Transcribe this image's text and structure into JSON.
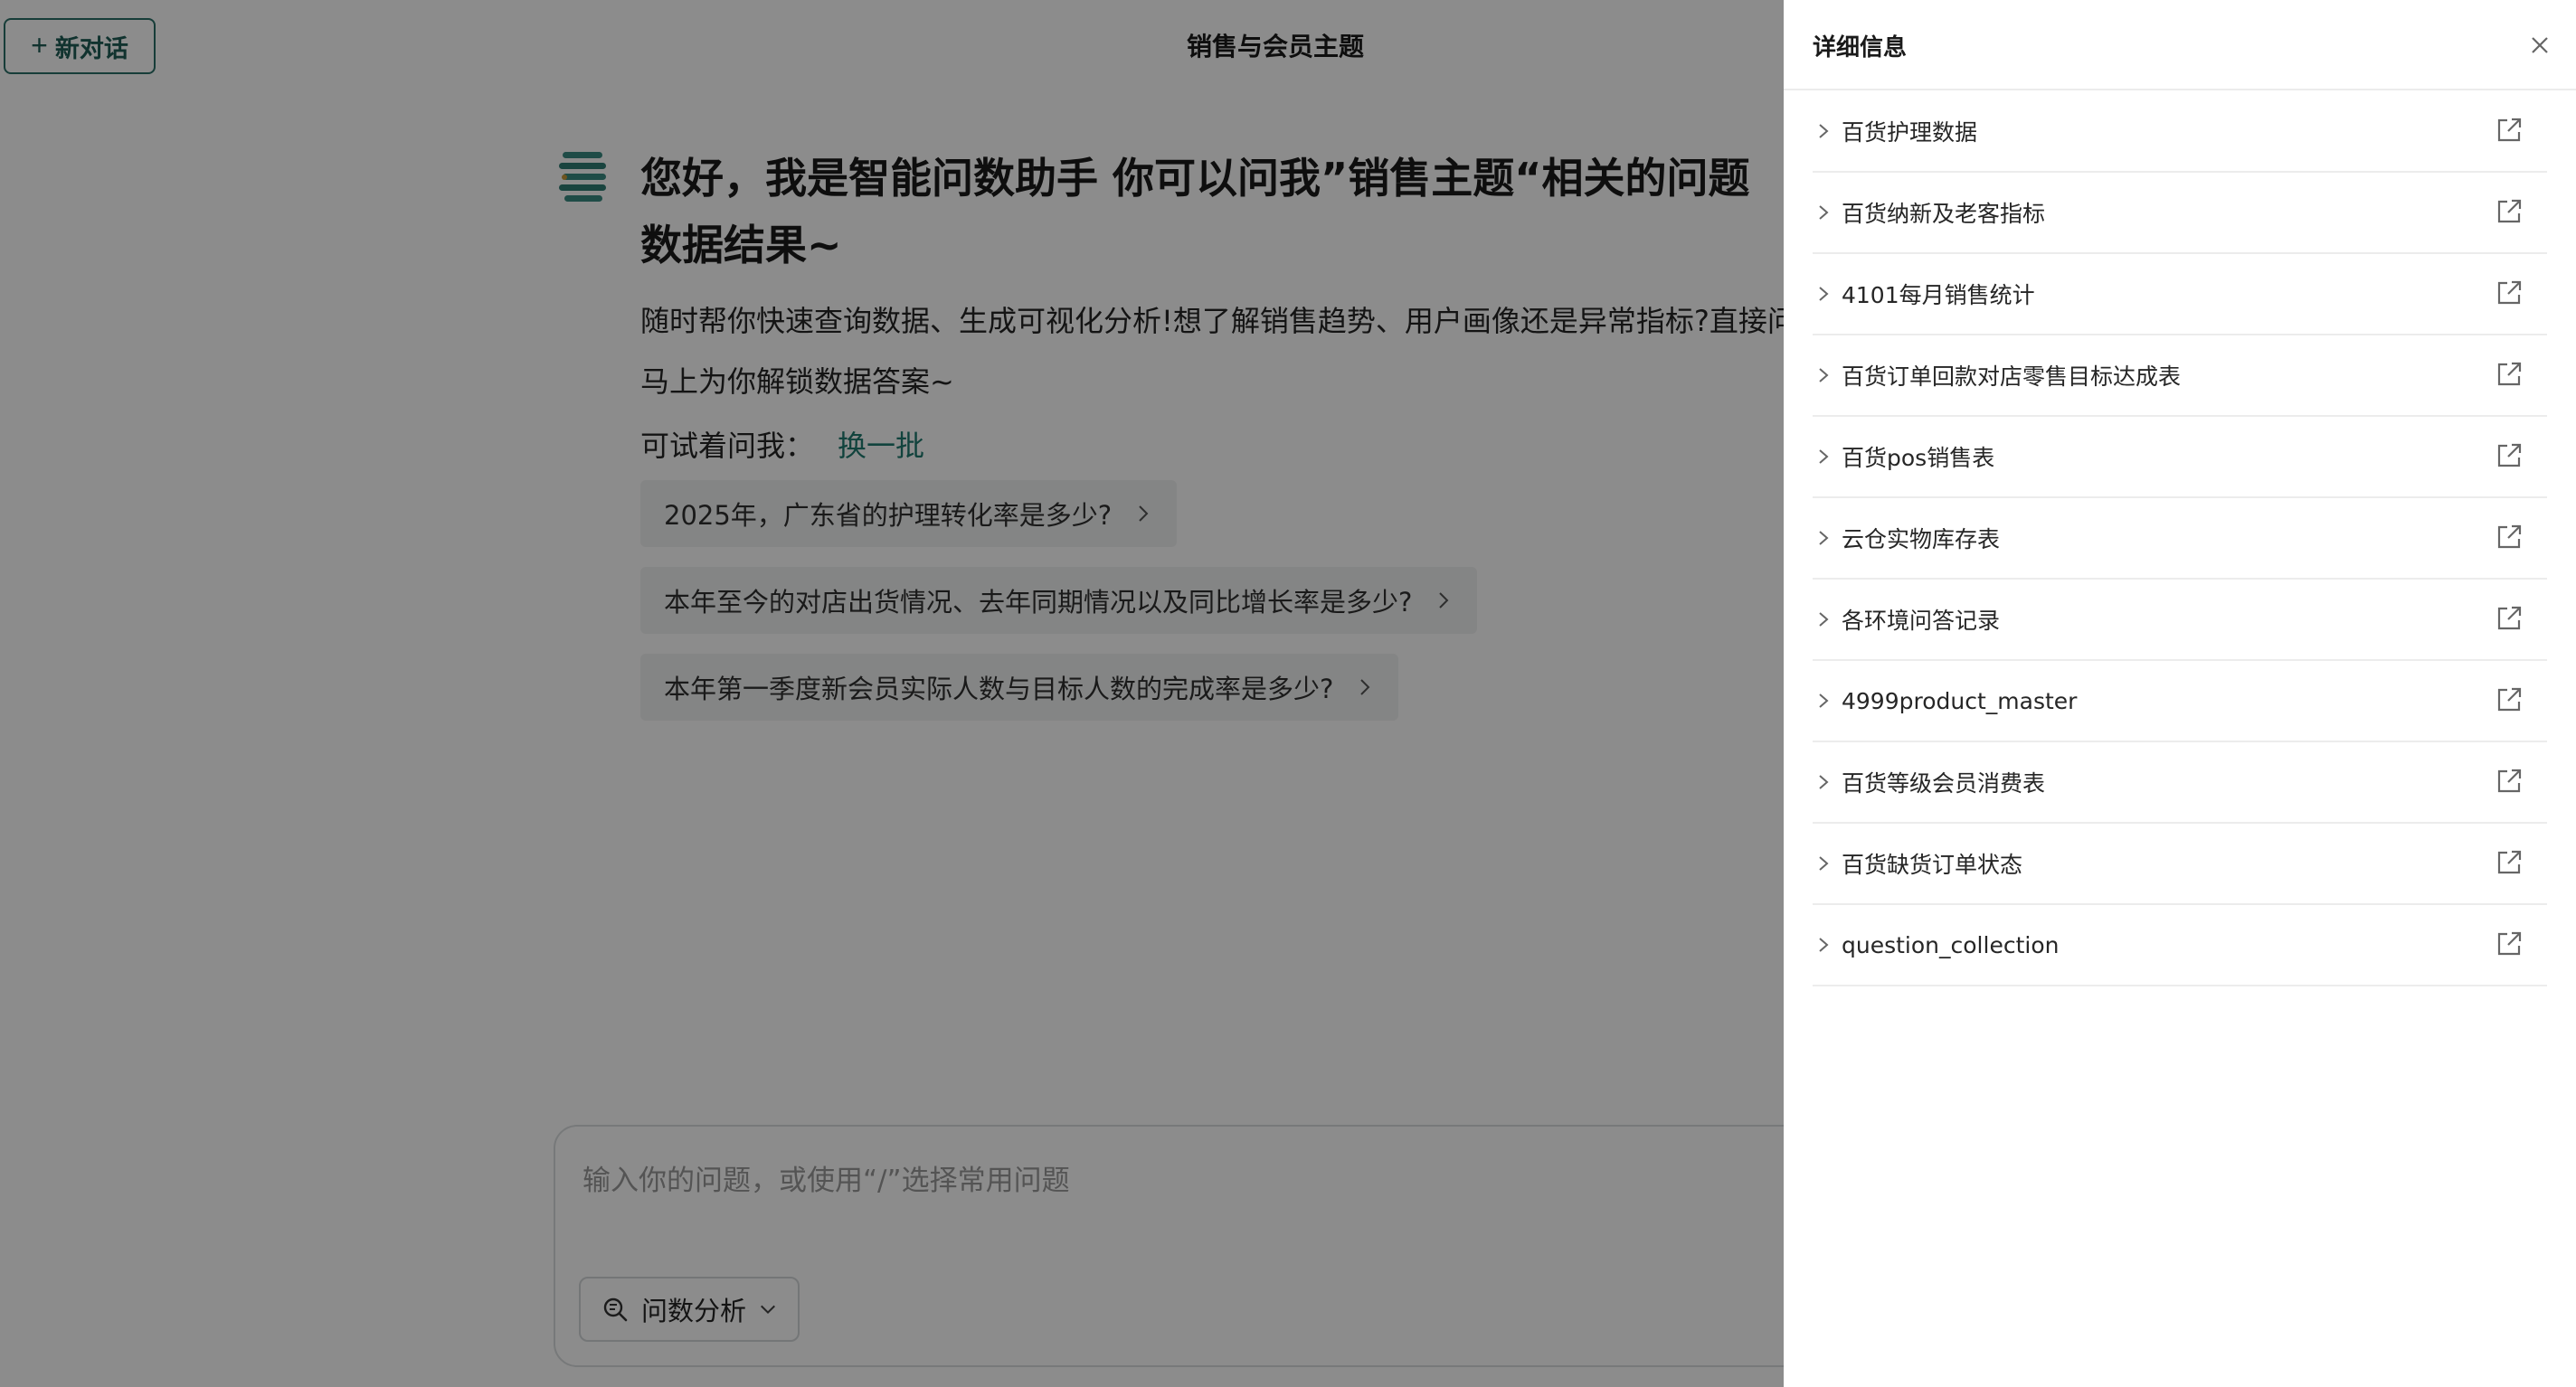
{
  "header": {
    "new_chat_label": "新对话",
    "title": "销售与会员主题"
  },
  "welcome": {
    "greeting_line1": "您好，我是智能问数助手 你可以问我”销售主题“相关的问题",
    "greeting_line2": "数据结果~",
    "intro_line1": "随时帮你快速查询数据、生成可视化分析!想了解销售趋势、用户画像还是异常指标?直接问",
    "intro_line2": "马上为你解锁数据答案~",
    "try_label": "可试着问我：",
    "refresh_label": "换一批",
    "suggestions": [
      "2025年，广东省的护理转化率是多少?",
      "本年至今的对店出货情况、去年同期情况以及同比增长率是多少?",
      "本年第一季度新会员实际人数与目标人数的完成率是多少?"
    ]
  },
  "composer": {
    "placeholder": "输入你的问题，或使用“/”选择常用问题",
    "mode_label": "问数分析"
  },
  "drawer": {
    "title": "详细信息",
    "items": [
      "百货护理数据",
      "百货纳新及老客指标",
      "4101每月销售统计",
      "百货订单回款对店零售目标达成表",
      "百货pos销售表",
      "云仓实物库存表",
      "各环境问答记录",
      "4999product_master",
      "百货等级会员消费表",
      "百货缺货订单状态",
      "question_collection"
    ]
  },
  "colors": {
    "accent": "#1f7a6f",
    "mask": "rgba(0,0,0,0.45)"
  }
}
